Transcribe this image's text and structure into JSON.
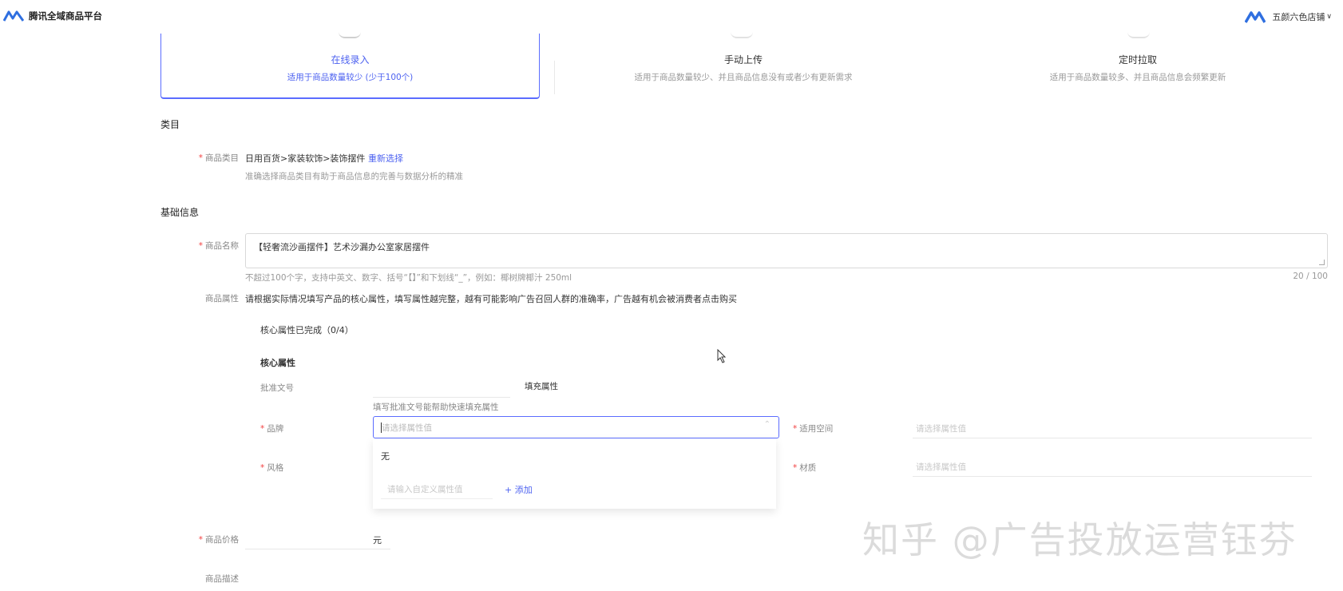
{
  "header": {
    "app_title": "腾讯全域商品平台",
    "store_name": "五颜六色店铺",
    "store_chevron": "∨"
  },
  "upload_methods": [
    {
      "title": "在线录入",
      "desc": "适用于商品数量较少 (少于100个)"
    },
    {
      "title": "手动上传",
      "desc": "适用于商品数量较少、并且商品信息没有或者少有更新需求"
    },
    {
      "title": "定时拉取",
      "desc": "适用于商品数量较多、并且商品信息会频繁更新"
    }
  ],
  "category_section": {
    "heading": "类目",
    "label": "商品类目",
    "value": "日用百货>家装软饰>装饰摆件",
    "reselect": "重新选择",
    "hint": "准确选择商品类目有助于商品信息的完善与数据分析的精准"
  },
  "basic_section": {
    "heading": "基础信息",
    "name_label": "商品名称",
    "name_value": "【轻奢流沙画摆件】艺术沙漏办公室家居摆件",
    "name_hint": "不超过100个字，支持中英文、数字、括号“【】”和下划线“_”，例如：椰树牌椰汁 250ml",
    "name_count": "20 / 100",
    "attr_label": "商品属性",
    "attr_desc": "请根据实际情况填写产品的核心属性，填写属性越完整，越有可能影响广告召回人群的准确率，广告越有机会被消费者点击购买",
    "attr_progress": "核心属性已完成（0/4）",
    "core_title": "核心属性",
    "approval_label": "批准文号",
    "fill_button": "填充属性",
    "approval_hint": "填写批准文号能帮助快速填充属性",
    "brand_label": "品牌",
    "brand_placeholder": "请选择属性值",
    "space_label": "适用空间",
    "space_placeholder": "请选择属性值",
    "style_label": "风格",
    "material_label": "材质",
    "material_placeholder": "请选择属性值",
    "dropdown_none": "无",
    "custom_placeholder": "请输入自定义属性值",
    "add_label": "+ 添加",
    "price_label": "商品价格",
    "price_unit": "元",
    "desc_label": "商品描述"
  },
  "watermark": "知乎 @广告投放运营钰芬",
  "colors": {
    "accent": "#4d62f0",
    "required": "#f24040"
  }
}
